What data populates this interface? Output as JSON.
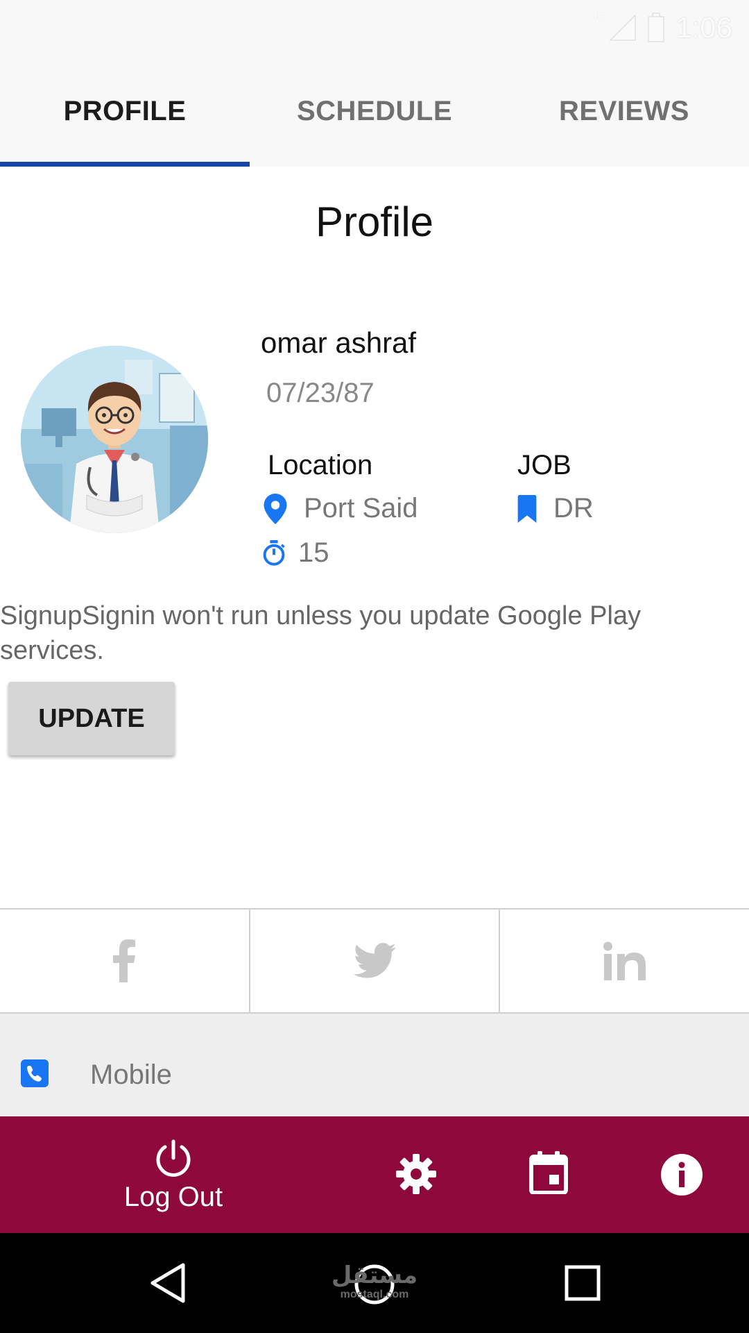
{
  "status_bar": {
    "network": "4G",
    "time": "1:06"
  },
  "tabs": [
    {
      "label": "PROFILE",
      "active": true
    },
    {
      "label": "SCHEDULE",
      "active": false
    },
    {
      "label": "REVIEWS",
      "active": false
    }
  ],
  "page_title": "Profile",
  "profile": {
    "name": "omar ashraf",
    "dob": "07/23/87",
    "location_label": "Location",
    "location": "Port Said",
    "job_label": "JOB",
    "job": "DR",
    "count": "15"
  },
  "notice": "SignupSignin won't run unless you update Google Play services.",
  "update_button": "UPDATE",
  "social": [
    {
      "icon": "facebook-icon"
    },
    {
      "icon": "twitter-icon"
    },
    {
      "icon": "linkedin-icon"
    }
  ],
  "contact": {
    "icon": "phone-icon",
    "label": "Mobile"
  },
  "bottom_bar": {
    "logout_label": "Log Out",
    "icons": [
      "power-icon",
      "gear-icon",
      "calendar-icon",
      "info-icon"
    ]
  },
  "watermark": {
    "arabic": "مستقل",
    "latin": "mostaql.com"
  },
  "colors": {
    "accent_blue": "#1976f2",
    "tab_indicator": "#1745a8",
    "bottom_bar": "#8e083c",
    "social_icon": "#c8c8c8"
  }
}
